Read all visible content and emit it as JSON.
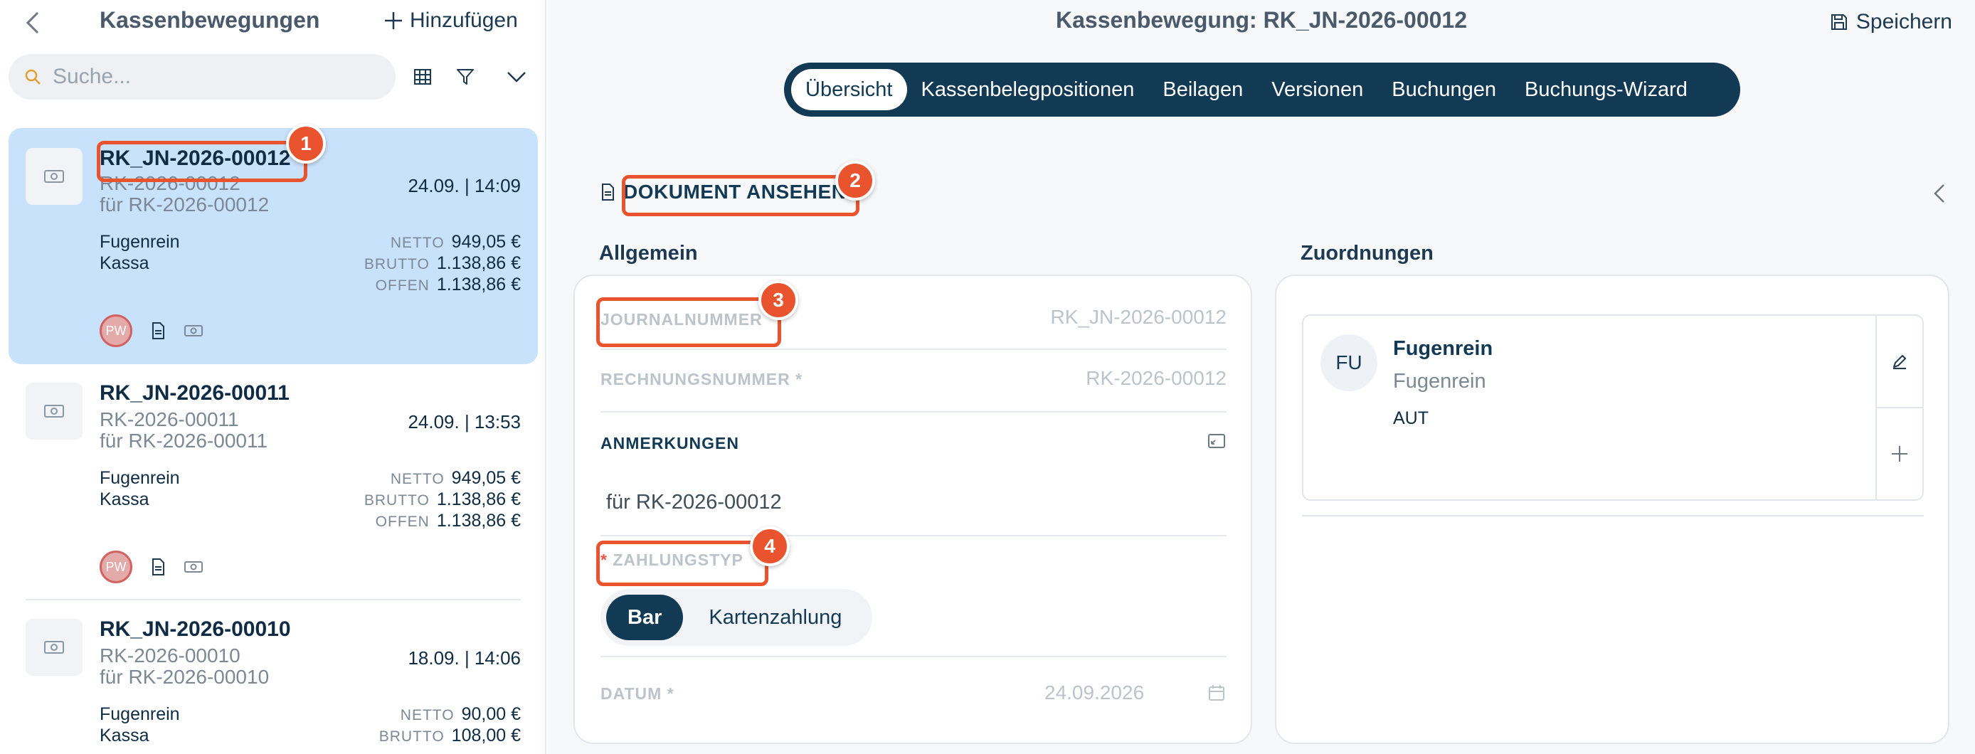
{
  "sidebar": {
    "title": "Kassenbewegungen",
    "add_label": "Hinzufügen",
    "search_placeholder": "Suche...",
    "items": [
      {
        "journal": "RK_JN-2026-00012",
        "invoice": "RK-2026-00012",
        "note": "für RK-2026-00012",
        "date": "24.09. | 14:09",
        "vendor": "Fugenrein",
        "account": "Kassa",
        "netto_label": "NETTO",
        "netto": "949,05 €",
        "brutto_label": "BRUTTO",
        "brutto": "1.138,86 €",
        "offen_label": "OFFEN",
        "offen": "1.138,86 €",
        "avatar": "PW"
      },
      {
        "journal": "RK_JN-2026-00011",
        "invoice": "RK-2026-00011",
        "note": "für RK-2026-00011",
        "date": "24.09. | 13:53",
        "vendor": "Fugenrein",
        "account": "Kassa",
        "netto_label": "NETTO",
        "netto": "949,05 €",
        "brutto_label": "BRUTTO",
        "brutto": "1.138,86 €",
        "offen_label": "OFFEN",
        "offen": "1.138,86 €",
        "avatar": "PW"
      },
      {
        "journal": "RK_JN-2026-00010",
        "invoice": "RK-2026-00010",
        "note": "für RK-2026-00010",
        "date": "18.09. | 14:06",
        "vendor": "Fugenrein",
        "account": "Kassa",
        "netto_label": "NETTO",
        "netto": "90,00 €",
        "brutto_label": "BRUTTO",
        "brutto": "108,00 €"
      }
    ]
  },
  "main": {
    "title": "Kassenbewegung: RK_JN-2026-00012",
    "save_label": "Speichern",
    "tabs": [
      {
        "label": "Übersicht"
      },
      {
        "label": "Kassenbelegpositionen"
      },
      {
        "label": "Beilagen"
      },
      {
        "label": "Versionen"
      },
      {
        "label": "Buchungen"
      },
      {
        "label": "Buchungs-Wizard"
      }
    ],
    "doc_link": "DOKUMENT ANSEHEN",
    "general": {
      "title": "Allgemein",
      "journal_label": "JOURNALNUMMER",
      "journal_value": "RK_JN-2026-00012",
      "invoice_label": "RECHNUNGSNUMMER *",
      "invoice_value": "RK-2026-00012",
      "notes_label": "ANMERKUNGEN",
      "notes_value": "für RK-2026-00012",
      "payment_req": "*",
      "payment_label": "ZAHLUNGSTYP",
      "payment_options": [
        "Bar",
        "Kartenzahlung"
      ],
      "date_label": "DATUM *",
      "date_value": "24.09.2026"
    },
    "assignments": {
      "title": "Zuordnungen",
      "avatar": "FU",
      "name": "Fugenrein",
      "subname": "Fugenrein",
      "country": "AUT"
    }
  },
  "annotations": [
    "1",
    "2",
    "3",
    "4"
  ],
  "colors": {
    "navy": "#123a55",
    "selected_bg": "#c9e2fb",
    "highlight": "#e9542f"
  }
}
